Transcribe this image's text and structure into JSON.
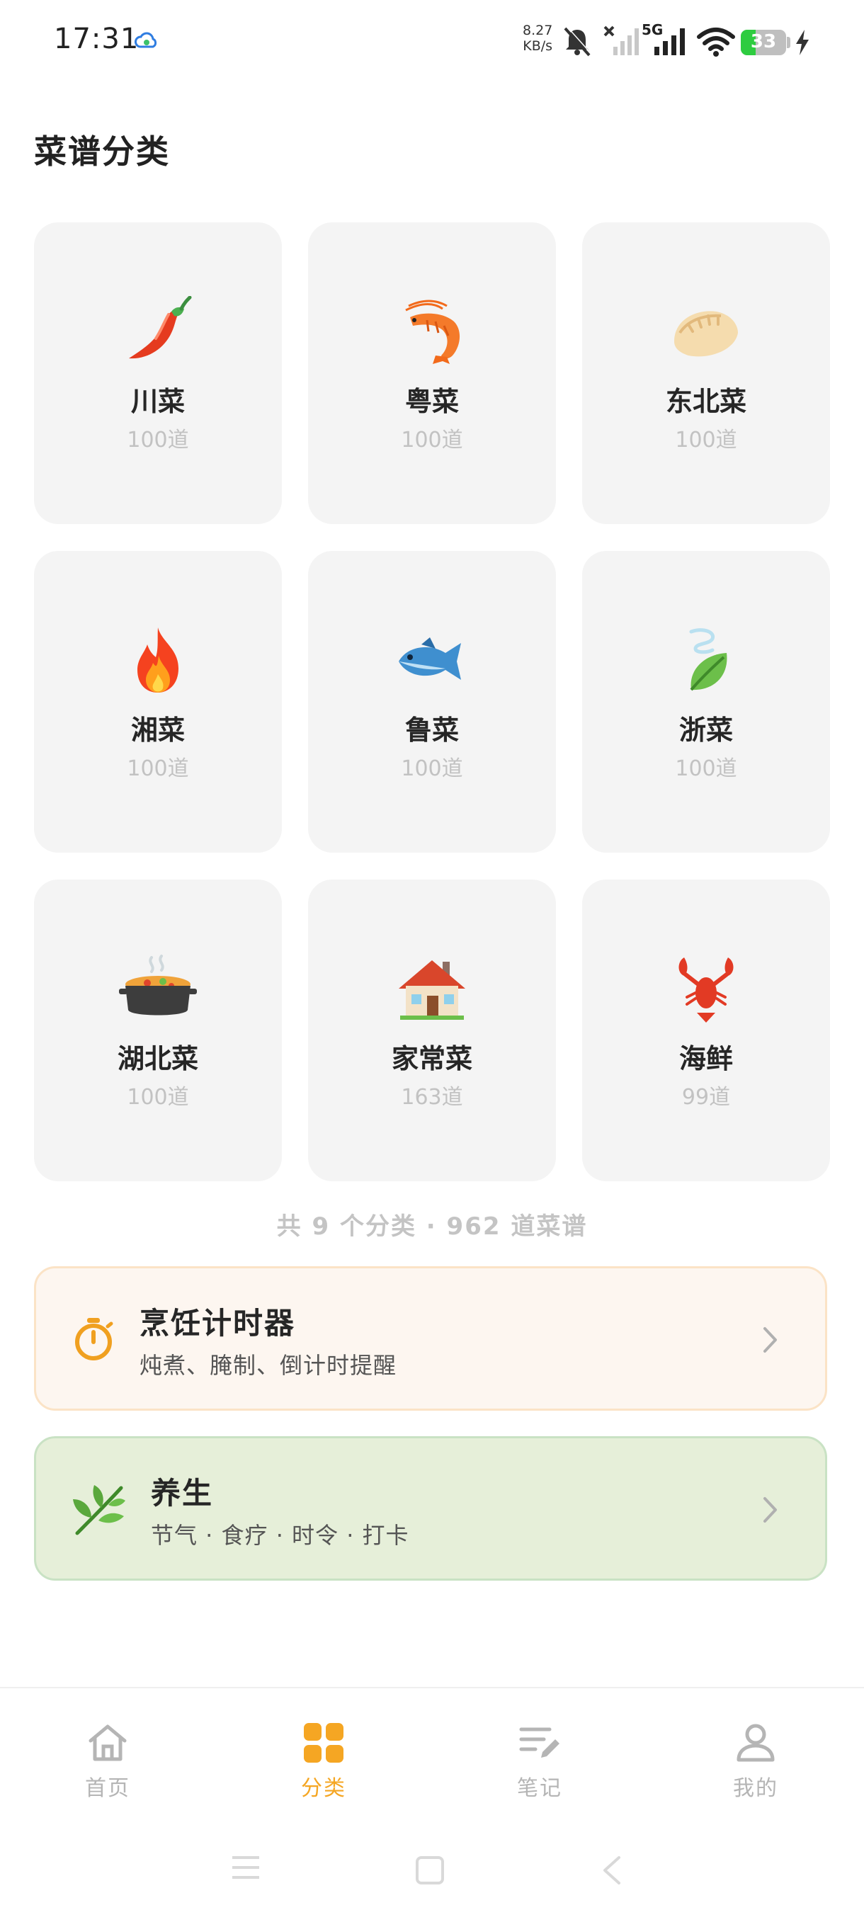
{
  "status_bar": {
    "time": "17:31",
    "net_speed_value": "8.27",
    "net_speed_unit": "KB/s",
    "network": "5G",
    "battery": "33"
  },
  "page": {
    "title": "菜谱分类"
  },
  "categories": [
    {
      "name": "川菜",
      "count": "100道",
      "icon": "chili-pepper-icon"
    },
    {
      "name": "粤菜",
      "count": "100道",
      "icon": "shrimp-icon"
    },
    {
      "name": "东北菜",
      "count": "100道",
      "icon": "dumpling-icon"
    },
    {
      "name": "湘菜",
      "count": "100道",
      "icon": "fire-icon"
    },
    {
      "name": "鲁菜",
      "count": "100道",
      "icon": "fish-icon"
    },
    {
      "name": "浙菜",
      "count": "100道",
      "icon": "leaf-wind-icon"
    },
    {
      "name": "湖北菜",
      "count": "100道",
      "icon": "pot-of-food-icon"
    },
    {
      "name": "家常菜",
      "count": "163道",
      "icon": "house-icon"
    },
    {
      "name": "海鲜",
      "count": "99道",
      "icon": "lobster-icon"
    }
  ],
  "summary": "共 9 个分类 · 962 道菜谱",
  "timer_card": {
    "title": "烹饪计时器",
    "subtitle": "炖煮、腌制、倒计时提醒",
    "icon": "stopwatch-icon"
  },
  "health_card": {
    "title": "养生",
    "subtitle": "节气 · 食疗 · 时令 · 打卡",
    "icon": "herb-icon"
  },
  "bottom_nav": [
    {
      "label": "首页",
      "icon": "home-icon",
      "active": false
    },
    {
      "label": "分类",
      "icon": "grid-icon",
      "active": true
    },
    {
      "label": "笔记",
      "icon": "notes-icon",
      "active": false
    },
    {
      "label": "我的",
      "icon": "profile-icon",
      "active": false
    }
  ],
  "colors": {
    "accent": "#f5a623",
    "card_bg": "#f4f4f4",
    "timer_bg": "#fdf6f0",
    "health_bg": "#e6efd9"
  }
}
